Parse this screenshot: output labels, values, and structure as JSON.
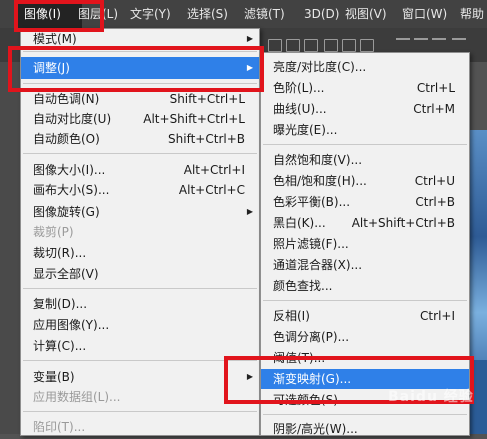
{
  "menubar": {
    "items": [
      "图像(I)",
      "图层(L)",
      "文字(Y)",
      "选择(S)",
      "滤镜(T)",
      "3D(D)",
      "视图(V)",
      "窗口(W)",
      "帮助"
    ],
    "active_index": 0
  },
  "image_menu": {
    "items": [
      {
        "label": "模式(M)",
        "shortcut": "",
        "submenu": true,
        "disabled": false
      },
      {
        "label": "调整(J)",
        "shortcut": "",
        "submenu": true,
        "disabled": false,
        "highlighted": true
      },
      {
        "label": "自动色调(N)",
        "shortcut": "Shift+Ctrl+L"
      },
      {
        "label": "自动对比度(U)",
        "shortcut": "Alt+Shift+Ctrl+L"
      },
      {
        "label": "自动颜色(O)",
        "shortcut": "Shift+Ctrl+B"
      },
      {
        "label": "图像大小(I)...",
        "shortcut": "Alt+Ctrl+I"
      },
      {
        "label": "画布大小(S)...",
        "shortcut": "Alt+Ctrl+C"
      },
      {
        "label": "图像旋转(G)",
        "shortcut": "",
        "submenu": true
      },
      {
        "label": "裁剪(P)",
        "shortcut": "",
        "disabled": true
      },
      {
        "label": "裁切(R)...",
        "shortcut": ""
      },
      {
        "label": "显示全部(V)",
        "shortcut": ""
      },
      {
        "label": "复制(D)...",
        "shortcut": ""
      },
      {
        "label": "应用图像(Y)...",
        "shortcut": ""
      },
      {
        "label": "计算(C)...",
        "shortcut": ""
      },
      {
        "label": "变量(B)",
        "shortcut": "",
        "submenu": true
      },
      {
        "label": "应用数据组(L)...",
        "shortcut": "",
        "disabled": true
      },
      {
        "label": "陷印(T)...",
        "shortcut": "",
        "disabled": true
      }
    ]
  },
  "adjust_menu": {
    "items": [
      {
        "label": "亮度/对比度(C)...",
        "shortcut": ""
      },
      {
        "label": "色阶(L)...",
        "shortcut": "Ctrl+L"
      },
      {
        "label": "曲线(U)...",
        "shortcut": "Ctrl+M"
      },
      {
        "label": "曝光度(E)...",
        "shortcut": ""
      },
      {
        "label": "自然饱和度(V)...",
        "shortcut": ""
      },
      {
        "label": "色相/饱和度(H)...",
        "shortcut": "Ctrl+U"
      },
      {
        "label": "色彩平衡(B)...",
        "shortcut": "Ctrl+B"
      },
      {
        "label": "黑白(K)...",
        "shortcut": "Alt+Shift+Ctrl+B"
      },
      {
        "label": "照片滤镜(F)...",
        "shortcut": ""
      },
      {
        "label": "通道混合器(X)...",
        "shortcut": ""
      },
      {
        "label": "颜色查找...",
        "shortcut": ""
      },
      {
        "label": "反相(I)",
        "shortcut": "Ctrl+I"
      },
      {
        "label": "色调分离(P)...",
        "shortcut": ""
      },
      {
        "label": "阈值(T)...",
        "shortcut": ""
      },
      {
        "label": "渐变映射(G)...",
        "shortcut": "",
        "highlighted": true
      },
      {
        "label": "可选颜色(S)...",
        "shortcut": ""
      },
      {
        "label": "阴影/高光(W)...",
        "shortcut": ""
      }
    ]
  },
  "watermark": "Baidu 经验",
  "colors": {
    "highlight": "#2f80e8",
    "annotation": "#e1141c",
    "menu_bg": "#f1f1f1",
    "menubar_bg": "#424242"
  }
}
